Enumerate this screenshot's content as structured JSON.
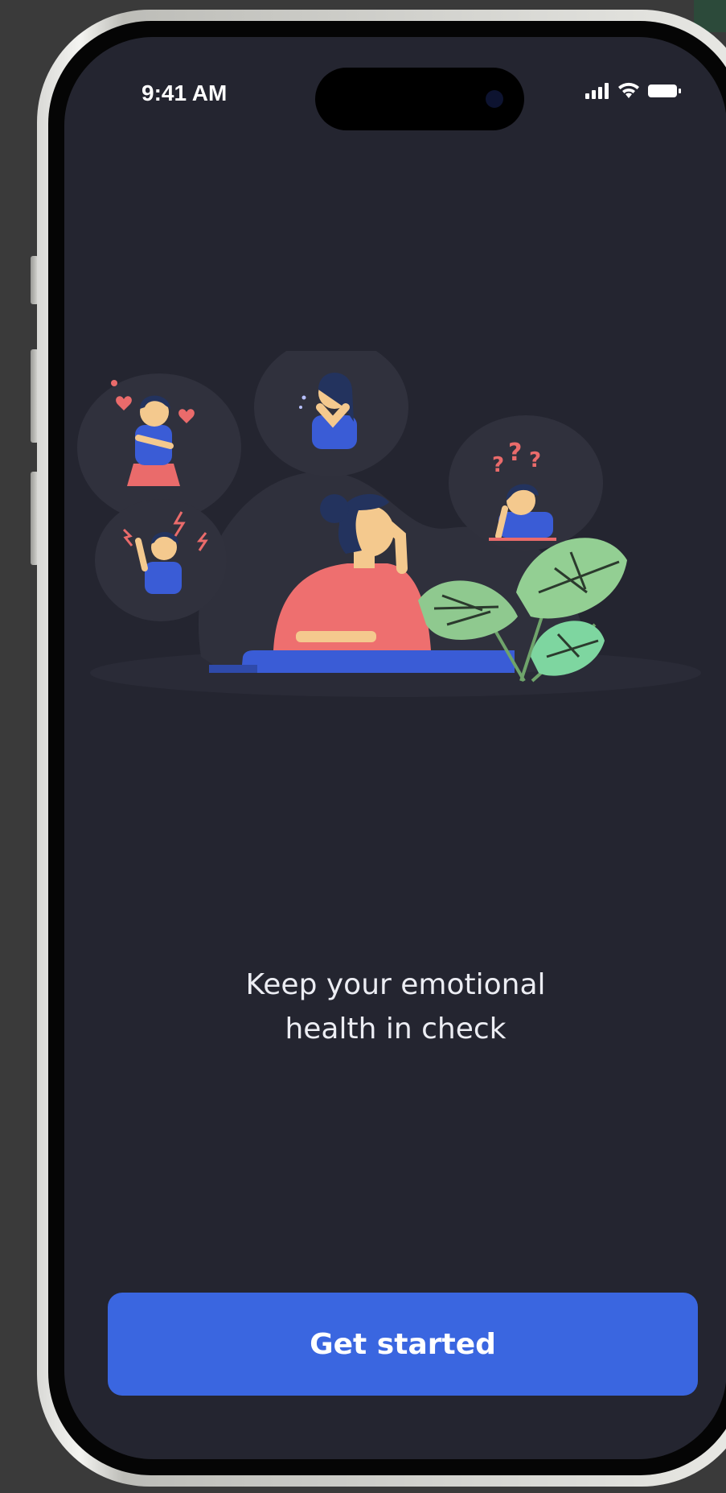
{
  "status_bar": {
    "time": "9:41 AM",
    "icons": [
      "cellular-signal-icon",
      "wifi-icon",
      "battery-icon"
    ]
  },
  "onboarding": {
    "headline": "Keep your emotional\nhealth in check",
    "cta_label": "Get started"
  },
  "colors": {
    "screen_bg": "#242530",
    "accent": "#3a66e0",
    "text": "#ecedf3"
  }
}
